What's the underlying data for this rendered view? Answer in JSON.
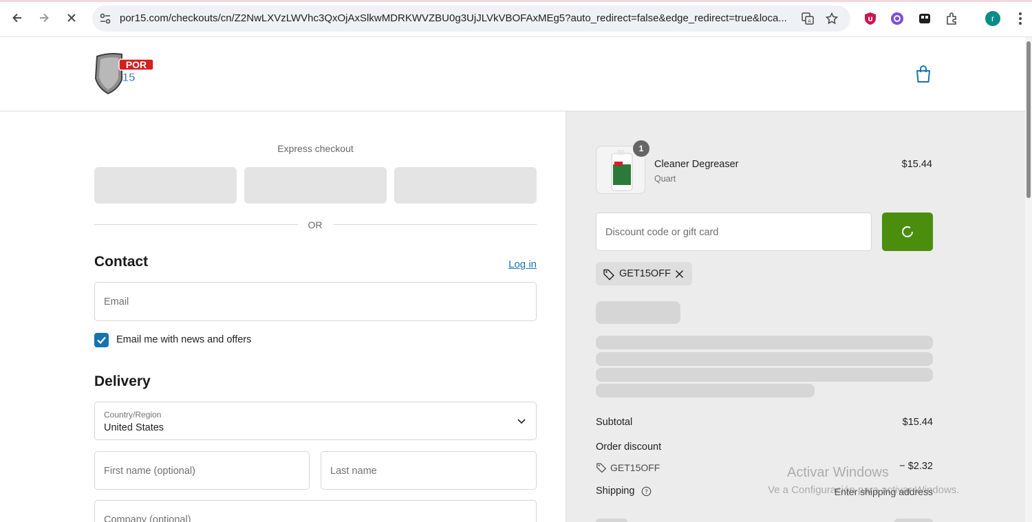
{
  "browser": {
    "url": "por15.com/checkouts/cn/Z2NwLXVzLWVhc3QxOjAxSlkwMDRKWVZBU0g3UjJLVkVBOFAxMEg5?auto_redirect=false&edge_redirect=true&loca...",
    "avatar_letter": "r"
  },
  "checkout": {
    "express_label": "Express checkout",
    "or_label": "OR",
    "contact_heading": "Contact",
    "login_label": "Log in",
    "email_placeholder": "Email",
    "newsletter_label": "Email me with news and offers",
    "newsletter_checked": true,
    "delivery_heading": "Delivery",
    "country_label": "Country/Region",
    "country_value": "United States",
    "first_name_placeholder": "First name (optional)",
    "last_name_placeholder": "Last name",
    "company_placeholder": "Company (optional)"
  },
  "order": {
    "item": {
      "quantity": "1",
      "name": "Cleaner Degreaser",
      "variant": "Quart",
      "price": "$15.44"
    },
    "discount_placeholder": "Discount code or gift card",
    "applied_code": "GET15OFF",
    "subtotal_label": "Subtotal",
    "subtotal_value": "$15.44",
    "order_discount_label": "Order discount",
    "order_discount_code": "GET15OFF",
    "order_discount_value": "− $2.32",
    "shipping_label": "Shipping",
    "shipping_value": "Enter shipping address"
  },
  "watermark": {
    "line1": "Activar Windows",
    "line2": "Ve a Configuración para activar Windows."
  },
  "colors": {
    "accent_blue": "#1773b0",
    "apply_green": "#4b8e0e",
    "summary_bg": "#ececec"
  }
}
